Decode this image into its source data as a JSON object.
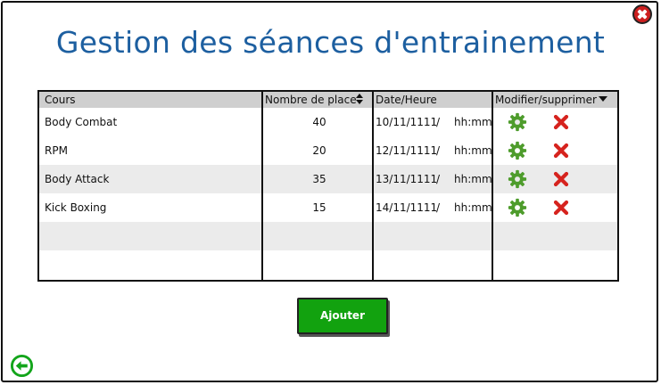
{
  "window": {
    "title": "Gestion des séances d'entrainement"
  },
  "table": {
    "columns": [
      {
        "label": "Cours"
      },
      {
        "label": "Nombre de place"
      },
      {
        "label": "Date/Heure"
      },
      {
        "label": "Modifier/supprimer"
      }
    ],
    "rows": [
      {
        "cours": "Body Combat",
        "places": "40",
        "date": "10/11/1111",
        "sep": "/",
        "time": "hh:mm"
      },
      {
        "cours": "RPM",
        "places": "20",
        "date": "12/11/1111",
        "sep": "/",
        "time": "hh:mm"
      },
      {
        "cours": "Body Attack",
        "places": "35",
        "date": "13/11/1111",
        "sep": "/",
        "time": "hh:mm"
      },
      {
        "cours": "Kick Boxing",
        "places": "15",
        "date": "14/11/1111",
        "sep": "/",
        "time": "hh:mm"
      }
    ],
    "empty_rows": 2
  },
  "actions": {
    "add_label": "Ajouter"
  },
  "icons": {
    "close": "close-icon",
    "back": "back-arrow-icon",
    "edit": "gear-icon",
    "delete": "delete-x-icon",
    "sort": "sort-icon",
    "dropdown": "dropdown-icon"
  },
  "colors": {
    "title": "#1d5fa0",
    "button": "#12a20f",
    "close": "#cc1f1f",
    "gear": "#4e9c2c",
    "delete": "#d6231e",
    "back": "#13a51b"
  }
}
